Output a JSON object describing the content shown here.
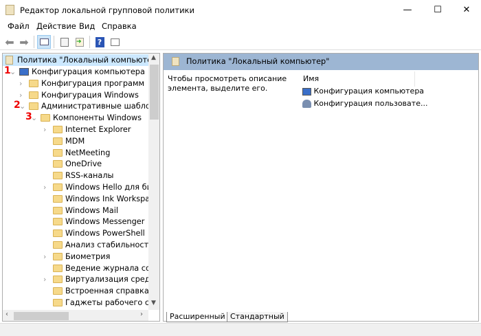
{
  "window": {
    "title": "Редактор локальной групповой политики",
    "minimize": "—",
    "maximize": "☐",
    "close": "✕"
  },
  "menu": [
    "Файл",
    "Действие",
    "Вид",
    "Справка"
  ],
  "toolbar": {
    "icons": [
      "back-icon",
      "forward-icon",
      "show-hide-tree-icon",
      "properties-icon",
      "export-list-icon",
      "help-icon",
      "extended-view-icon"
    ]
  },
  "tree": {
    "root": "Политика \"Локальный компьютер\"",
    "items": [
      {
        "label": "Конфигурация компьютера",
        "marker": "1"
      },
      {
        "label": "Конфигурация программ"
      },
      {
        "label": "Конфигурация Windows"
      },
      {
        "label": "Административные шаблоны",
        "marker": "2"
      },
      {
        "label": "Компоненты Windows",
        "marker": "3"
      },
      {
        "label": "Internet Explorer"
      },
      {
        "label": "MDM"
      },
      {
        "label": "NetMeeting"
      },
      {
        "label": "OneDrive"
      },
      {
        "label": "RSS-каналы"
      },
      {
        "label": "Windows Hello для бизн"
      },
      {
        "label": "Windows Ink Workspace"
      },
      {
        "label": "Windows Mail"
      },
      {
        "label": "Windows Messenger"
      },
      {
        "label": "Windows PowerShell"
      },
      {
        "label": "Анализ стабильности W"
      },
      {
        "label": "Биометрия"
      },
      {
        "label": "Ведение журнала собы"
      },
      {
        "label": "Виртуализация средств"
      },
      {
        "label": "Встроенная справка"
      },
      {
        "label": "Гаджеты рабочего стол"
      }
    ]
  },
  "right": {
    "header": "Политика \"Локальный компьютер\"",
    "description": "Чтобы просмотреть описание элемента, выделите его.",
    "column": "Имя",
    "items": [
      "Конфигурация компьютера",
      "Конфигурация пользовате..."
    ],
    "tabs": [
      "Расширенный",
      "Стандартный"
    ]
  },
  "colors": {
    "header": "#9db6d3",
    "marker": "#e00000",
    "folder": "#f6d98a"
  }
}
